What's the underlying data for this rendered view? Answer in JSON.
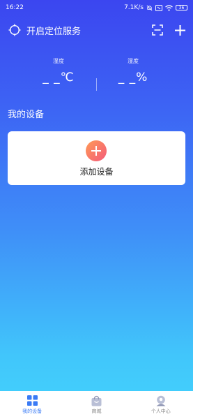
{
  "status_bar": {
    "time": "16:22",
    "network_speed": "7.1K/s",
    "battery": "36"
  },
  "header": {
    "location_label": "开启定位服务"
  },
  "weather": {
    "humidity_label": "湿度",
    "temperature_value": "_ _℃",
    "humidity_value": "_ _%"
  },
  "devices": {
    "section_title": "我的设备",
    "add_device_label": "添加设备"
  },
  "bottom_nav": {
    "items": [
      {
        "label": "我的设备",
        "icon": "grid-icon",
        "active": true
      },
      {
        "label": "商城",
        "icon": "shopping-bag-icon",
        "active": false
      },
      {
        "label": "个人中心",
        "icon": "person-icon",
        "active": false
      }
    ]
  },
  "colors": {
    "gradient_top": "#3b46f0",
    "gradient_bottom": "#43d3fc",
    "active_nav": "#3a7bf5",
    "add_button_start": "#ff9a56",
    "add_button_end": "#f35a7a"
  }
}
